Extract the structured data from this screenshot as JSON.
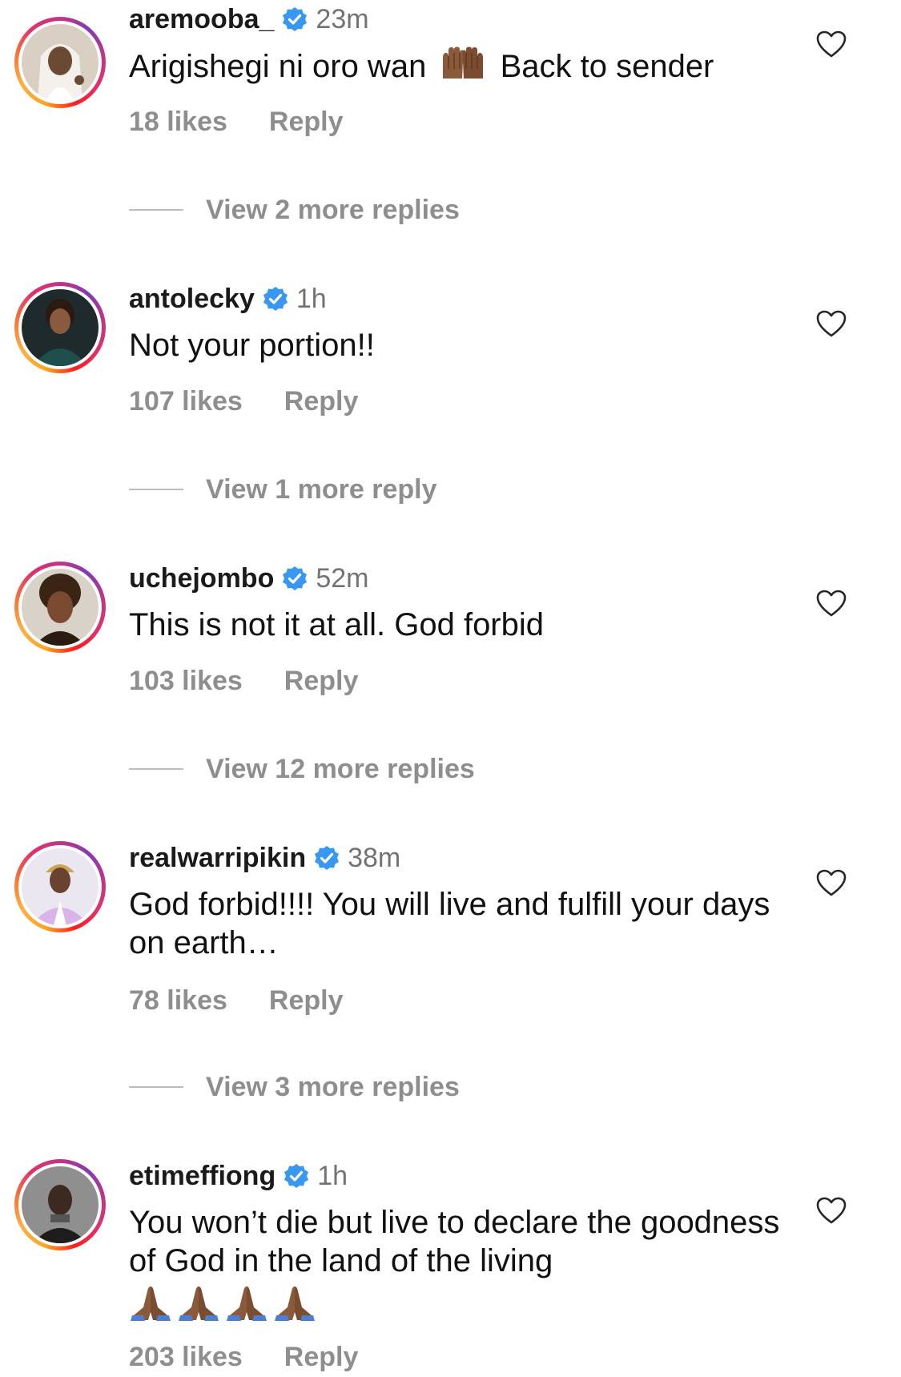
{
  "colors": {
    "verified_blue": "#3897f0",
    "meta_gray": "#8e8e8e",
    "ring_gradient": [
      "#f9a825",
      "#f77737",
      "#e1306c",
      "#c13584",
      "#833ab4"
    ]
  },
  "comments": [
    {
      "username": "aremooba_",
      "time": "23m",
      "text_before": "Arigishegi ni oro wan",
      "emoji": "raised-hands-icon",
      "text_after": "Back to sender",
      "likes": "18 likes",
      "reply": "Reply",
      "view_replies": "View 2 more replies"
    },
    {
      "username": "antolecky",
      "time": "1h",
      "text": "Not your portion!!",
      "likes": "107 likes",
      "reply": "Reply",
      "view_replies": "View 1 more reply"
    },
    {
      "username": "uchejombo",
      "time": "52m",
      "text": "This is not it at all. God forbid",
      "likes": "103 likes",
      "reply": "Reply",
      "view_replies": "View 12 more replies"
    },
    {
      "username": "realwarripikin",
      "time": "38m",
      "text": "God forbid!!!! You will live and fulfill your days on earth…",
      "likes": "78 likes",
      "reply": "Reply",
      "view_replies": "View 3 more replies"
    },
    {
      "username": "etimeffiong",
      "time": "1h",
      "text": "You won’t die but live to declare the goodness of God in the land of the living",
      "emoji": "folded-hands-icon",
      "emoji_count": 4,
      "likes": "203 likes",
      "reply": "Reply"
    }
  ]
}
